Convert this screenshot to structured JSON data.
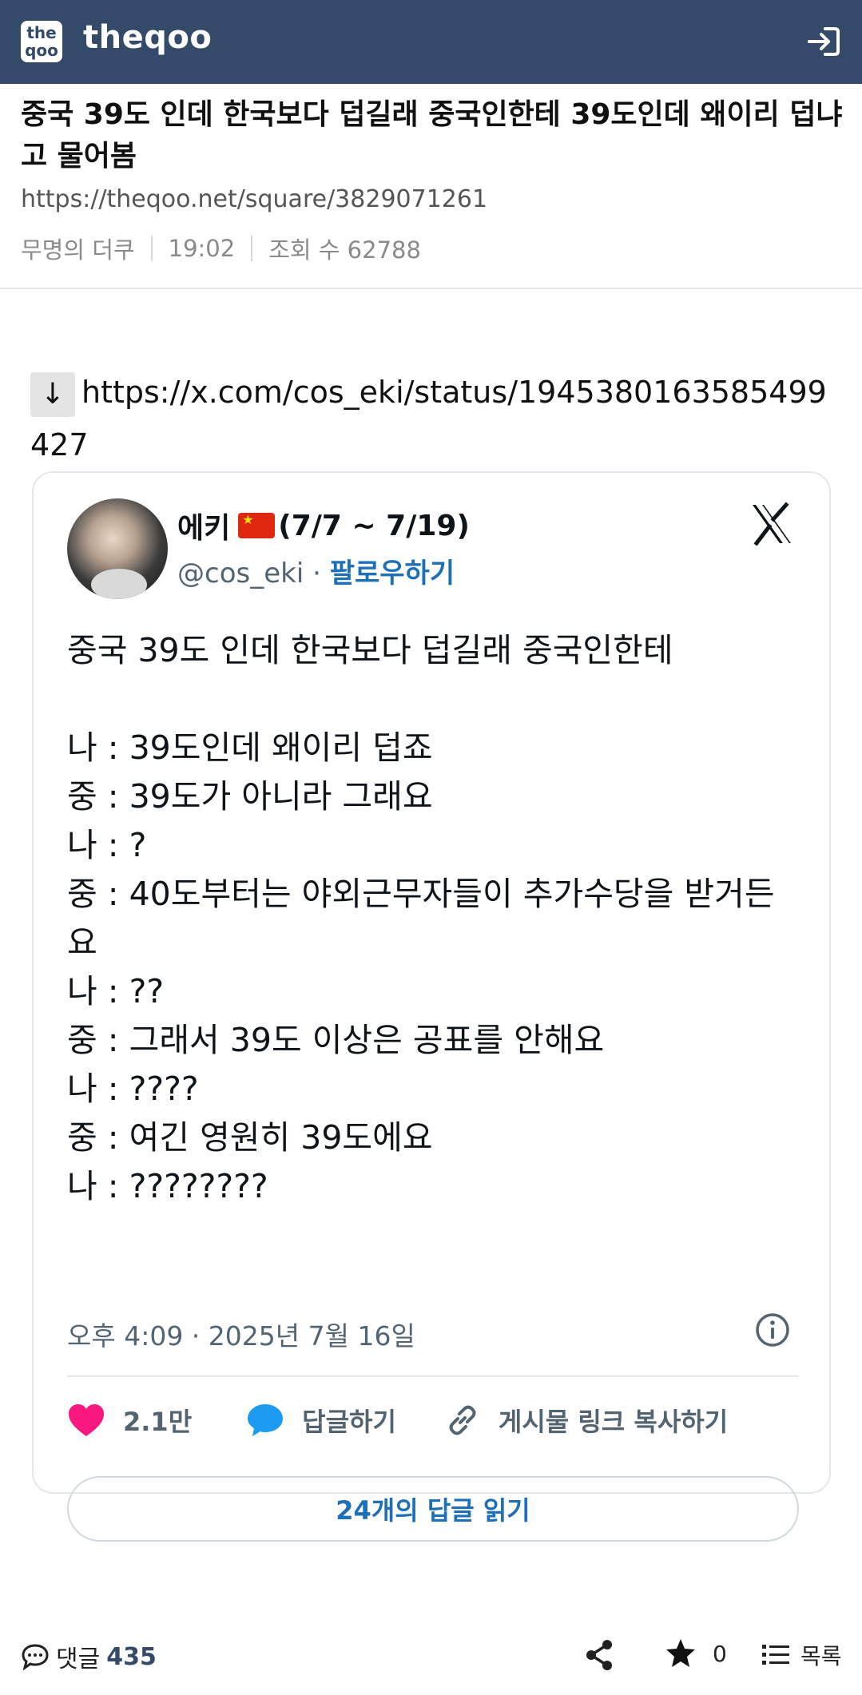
{
  "header": {
    "logo_text_top": "the",
    "logo_text_bottom": "qoo",
    "brand": "theqoo",
    "login_icon": "login-icon"
  },
  "post": {
    "title": "중국 39도 인데 한국보다 덥길래 중국인한테 39도인데 왜이리 덥냐고 물어봄",
    "url": "https://theqoo.net/square/3829071261",
    "author": "무명의 더쿠",
    "time": "19:02",
    "views": "조회 수 62788",
    "body_link_arrow": "↓",
    "body_link": "https://x.com/cos_eki/status/1945380163585499427"
  },
  "tweet": {
    "author_name": "에키",
    "author_flag": "cn-flag",
    "author_suffix": "(7/7 ~ 7/19)",
    "handle": "@cos_eki",
    "separator": " · ",
    "follow_label": "팔로우하기",
    "text": "중국 39도 인데 한국보다 덥길래 중국인한테\n\n나 : 39도인데 왜이리 덥죠\n중 : 39도가 아니라 그래요\n나 : ?\n중 : 40도부터는 야외근무자들이 추가수당을 받거든요\n나 : ??\n중 : 그래서 39도 이상은 공표를 안해요\n나 : ????\n중 : 여긴 영원히 39도에요\n나 : ????????",
    "timestamp": "오후 4:09 · 2025년 7월 16일",
    "likes": "2.1만",
    "reply_label": "답글하기",
    "copy_link_label": "게시물 링크 복사하기",
    "read_replies_label": "24개의 답글 읽기",
    "colors": {
      "like": "#f91880",
      "reply": "#1d9bf0",
      "link": "#1d6fb8"
    }
  },
  "bottombar": {
    "comments_label": "댓글",
    "comments_count": "435",
    "favorites_count": "0",
    "list_label": "목록"
  },
  "colors": {
    "appbar": "#344a69"
  }
}
